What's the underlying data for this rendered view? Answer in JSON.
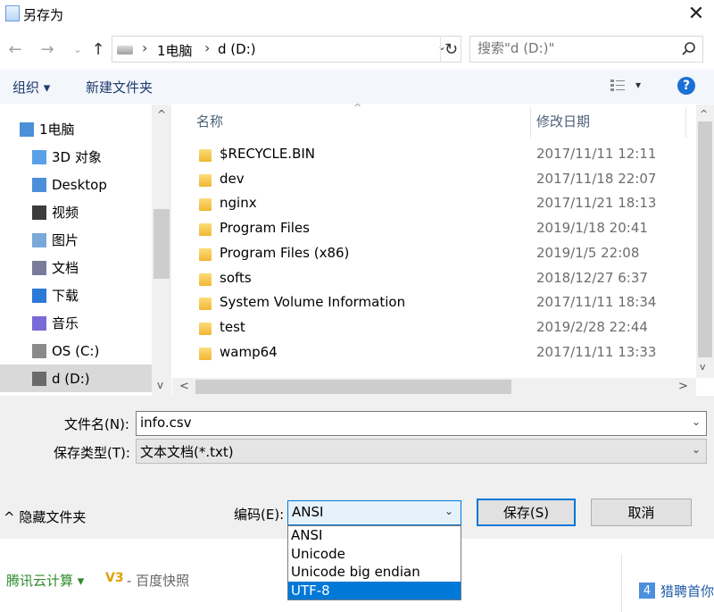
{
  "window": {
    "title": "另存为"
  },
  "address": {
    "crumbs": [
      "1电脑",
      "d (D:)"
    ],
    "search_placeholder": "搜索\"d (D:)\""
  },
  "toolbar": {
    "organize": "组织 ▾",
    "new_folder": "新建文件夹"
  },
  "nav": {
    "items": [
      {
        "label": "1电脑",
        "icon": "computer-icon"
      },
      {
        "label": "3D 对象",
        "icon": "3d-objects-icon"
      },
      {
        "label": "Desktop",
        "icon": "desktop-icon"
      },
      {
        "label": "视频",
        "icon": "video-icon"
      },
      {
        "label": "图片",
        "icon": "pictures-icon"
      },
      {
        "label": "文档",
        "icon": "documents-icon"
      },
      {
        "label": "下载",
        "icon": "downloads-icon"
      },
      {
        "label": "音乐",
        "icon": "music-icon"
      },
      {
        "label": "OS (C:)",
        "icon": "drive-os-icon"
      },
      {
        "label": "d (D:)",
        "icon": "drive-icon"
      }
    ]
  },
  "columns": {
    "name": "名称",
    "date": "修改日期"
  },
  "files": [
    {
      "name": "$RECYCLE.BIN",
      "date": "2017/11/11 12:11"
    },
    {
      "name": "dev",
      "date": "2017/11/18 22:07"
    },
    {
      "name": "nginx",
      "date": "2017/11/21 18:13"
    },
    {
      "name": "Program Files",
      "date": "2019/1/18 20:41"
    },
    {
      "name": "Program Files (x86)",
      "date": "2019/1/5 22:08"
    },
    {
      "name": "softs",
      "date": "2018/12/27 6:37"
    },
    {
      "name": "System Volume Information",
      "date": "2017/11/11 18:34"
    },
    {
      "name": "test",
      "date": "2019/2/28 22:44"
    },
    {
      "name": "wamp64",
      "date": "2017/11/11 13:33"
    }
  ],
  "form": {
    "filename_label": "文件名(N):",
    "filename_value": "info.csv",
    "filetype_label": "保存类型(T):",
    "filetype_value": "文本文档(*.txt)",
    "hide_folders": "隐藏文件夹",
    "encoding_label": "编码(E):",
    "encoding_value": "ANSI",
    "encoding_options": [
      "ANSI",
      "Unicode",
      "Unicode big endian",
      "UTF-8"
    ],
    "save": "保存(S)",
    "cancel": "取消"
  },
  "background": {
    "link1": "腾讯云计算 ▾",
    "v3": "V3",
    "link2": "- 百度快照",
    "badge": "4",
    "link3": "猎聘首你"
  },
  "colors": {
    "accent": "#0078d7",
    "folder": "#f0b732",
    "toolbar_text": "#1e3a6e"
  }
}
